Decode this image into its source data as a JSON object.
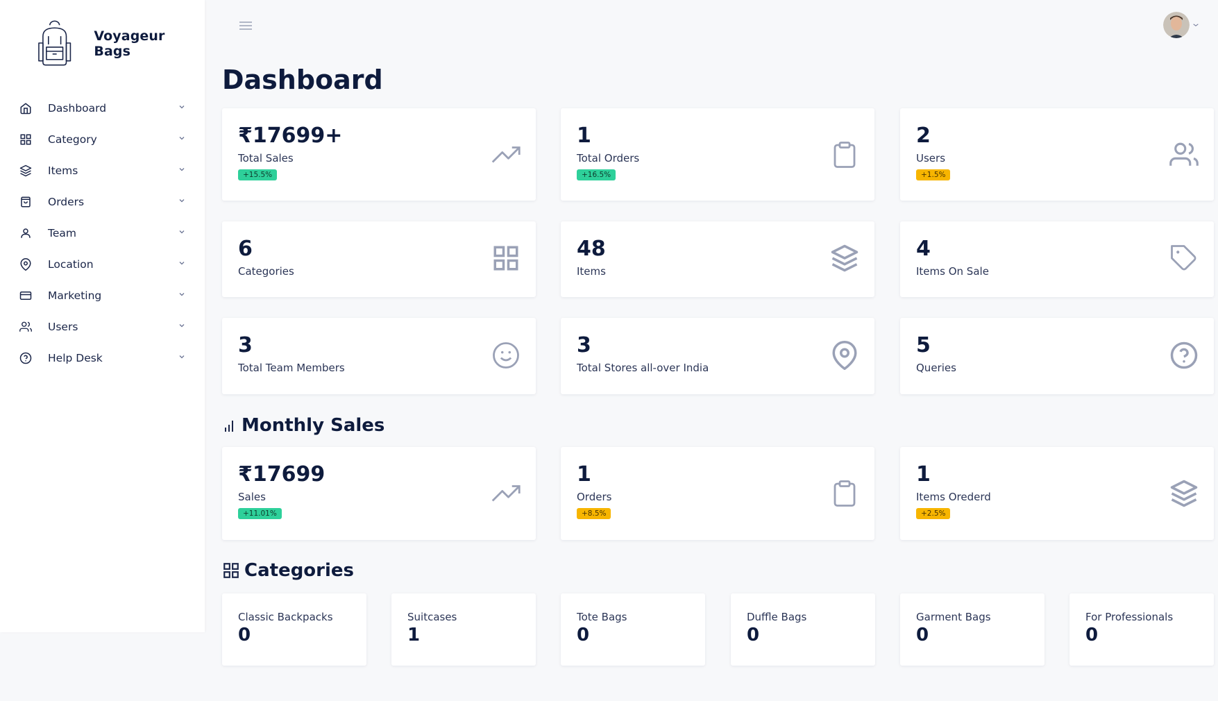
{
  "brand": {
    "name": "Voyageur Bags",
    "logo": "backpack-logo"
  },
  "sidebar": {
    "items": [
      {
        "label": "Dashboard",
        "icon": "home-icon"
      },
      {
        "label": "Category",
        "icon": "grid-icon"
      },
      {
        "label": "Items",
        "icon": "layers-icon"
      },
      {
        "label": "Orders",
        "icon": "bag-icon"
      },
      {
        "label": "Team",
        "icon": "user-icon"
      },
      {
        "label": "Location",
        "icon": "map-pin-icon"
      },
      {
        "label": "Marketing",
        "icon": "credit-card-icon"
      },
      {
        "label": "Users",
        "icon": "users-icon"
      },
      {
        "label": "Help Desk",
        "icon": "help-circle-icon"
      }
    ]
  },
  "header": {
    "menu_icon": "hamburger-icon",
    "avatar": "user-avatar"
  },
  "page": {
    "title": "Dashboard"
  },
  "stats": [
    {
      "value": "₹17699+",
      "label": "Total Sales",
      "badge": "+15.5%",
      "badge_color": "#2ed09a",
      "icon": "trending-up-icon"
    },
    {
      "value": "1",
      "label": "Total Orders",
      "badge": "+16.5%",
      "badge_color": "#2ed09a",
      "icon": "clipboard-icon"
    },
    {
      "value": "2",
      "label": "Users",
      "badge": "+1.5%",
      "badge_color": "#f7b500",
      "icon": "users-icon"
    },
    {
      "value": "6",
      "label": "Categories",
      "icon": "grid-icon"
    },
    {
      "value": "48",
      "label": "Items",
      "icon": "layers-icon"
    },
    {
      "value": "4",
      "label": "Items On Sale",
      "icon": "tag-icon"
    },
    {
      "value": "3",
      "label": "Total Team Members",
      "icon": "smile-icon"
    },
    {
      "value": "3",
      "label": "Total Stores all-over India",
      "icon": "map-pin-icon"
    },
    {
      "value": "5",
      "label": "Queries",
      "icon": "help-circle-icon"
    }
  ],
  "monthly": {
    "title": "Monthly Sales",
    "cards": [
      {
        "value": "₹17699",
        "label": "Sales",
        "badge": "+11.01%",
        "badge_color": "#2ed09a",
        "icon": "trending-up-icon"
      },
      {
        "value": "1",
        "label": "Orders",
        "badge": "+8.5%",
        "badge_color": "#f7b500",
        "icon": "clipboard-icon"
      },
      {
        "value": "1",
        "label": "Items Orederd",
        "badge": "+2.5%",
        "badge_color": "#f7b500",
        "icon": "layers-icon"
      }
    ]
  },
  "categories": {
    "title": "Categories",
    "items": [
      {
        "label": "Classic Backpacks",
        "value": "0"
      },
      {
        "label": "Suitcases",
        "value": "1"
      },
      {
        "label": "Tote Bags",
        "value": "0"
      },
      {
        "label": "Duffle Bags",
        "value": "0"
      },
      {
        "label": "Garment Bags",
        "value": "0"
      },
      {
        "label": "For Professionals",
        "value": "0"
      }
    ]
  }
}
